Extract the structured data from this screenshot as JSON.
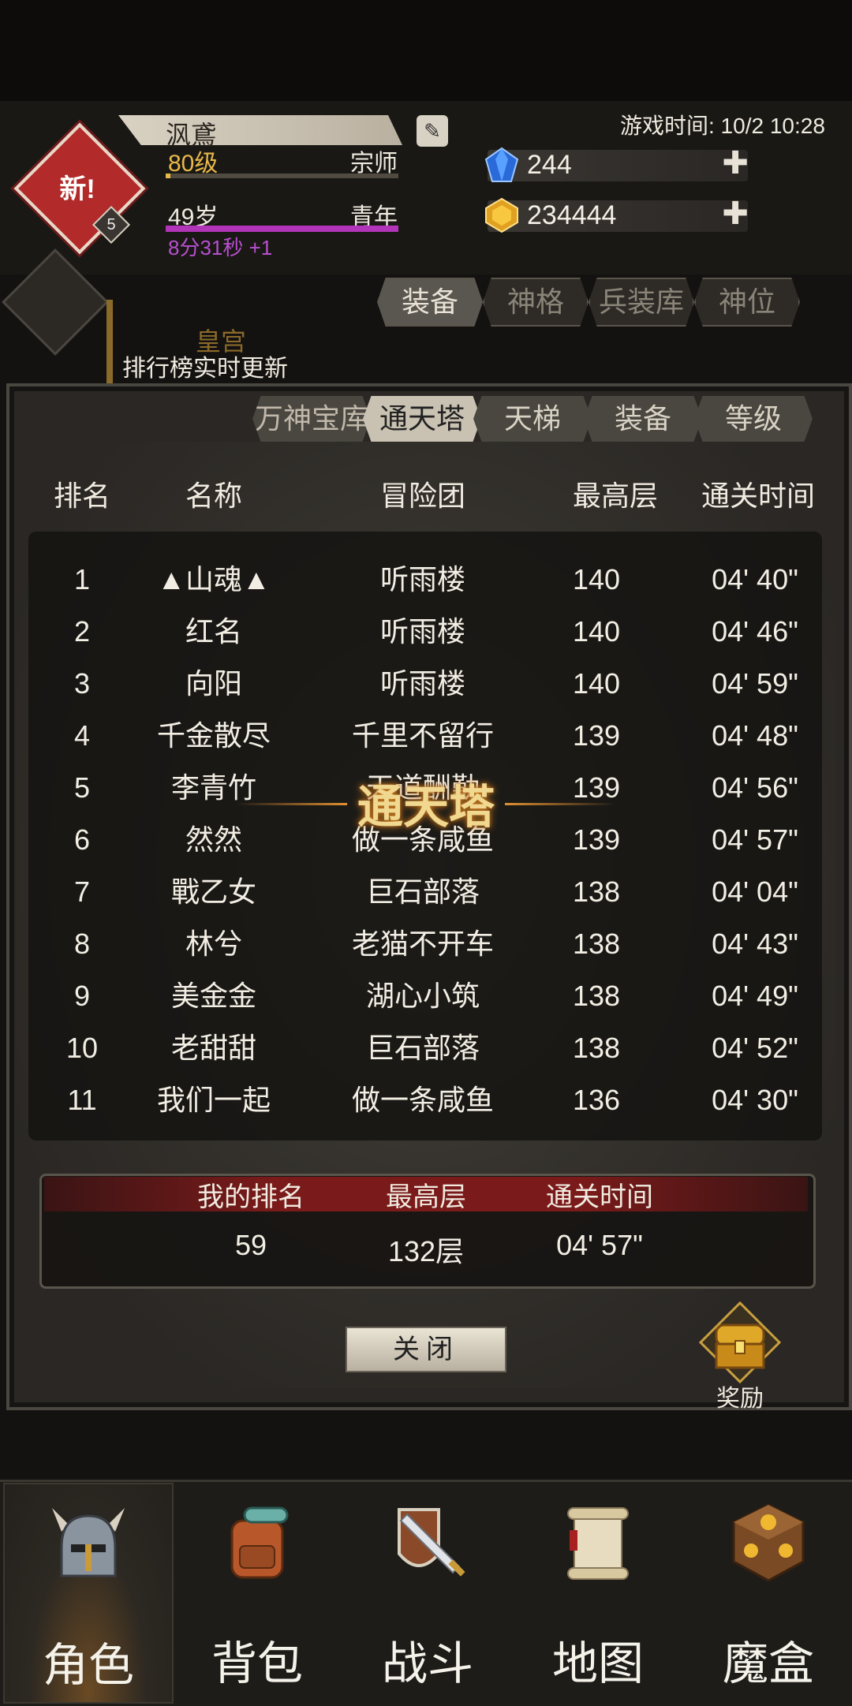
{
  "header": {
    "player_name": "沨鳶",
    "level": "80级",
    "rank_title": "宗师",
    "age": "49岁",
    "age_stage": "青年",
    "timer": "8分31秒 +1",
    "avatar_badge": "新!",
    "avatar_level": "5",
    "game_time": "游戏时间: 10/2 10:28",
    "currency": {
      "gems": "244",
      "gold": "234444"
    },
    "plus": "✚"
  },
  "top_tabs": [
    "装备",
    "神格",
    "兵装库",
    "神位"
  ],
  "background": {
    "palace": "皇宫",
    "realtime_notice": "排行榜实时更新"
  },
  "leaderboard": {
    "tabs": [
      "万神宝库",
      "通天塔",
      "天梯",
      "装备",
      "等级"
    ],
    "active_tab": "通天塔",
    "columns": [
      "排名",
      "名称",
      "冒险团",
      "最高层",
      "通关时间"
    ],
    "rows": [
      {
        "rank": "1",
        "name": "▲山魂▲",
        "guild": "听雨楼",
        "floor": "140",
        "time": "04' 40\""
      },
      {
        "rank": "2",
        "name": "红名",
        "guild": "听雨楼",
        "floor": "140",
        "time": "04' 46\""
      },
      {
        "rank": "3",
        "name": "向阳",
        "guild": "听雨楼",
        "floor": "140",
        "time": "04' 59\""
      },
      {
        "rank": "4",
        "name": "千金散尽",
        "guild": "千里不留行",
        "floor": "139",
        "time": "04' 48\""
      },
      {
        "rank": "5",
        "name": "李青竹",
        "guild": "天道酬勤",
        "floor": "139",
        "time": "04' 56\""
      },
      {
        "rank": "6",
        "name": "然然",
        "guild": "做一条咸鱼",
        "floor": "139",
        "time": "04' 57\""
      },
      {
        "rank": "7",
        "name": "戰乙女",
        "guild": "巨石部落",
        "floor": "138",
        "time": "04' 04\""
      },
      {
        "rank": "8",
        "name": "林兮",
        "guild": "老猫不开车",
        "floor": "138",
        "time": "04' 43\""
      },
      {
        "rank": "9",
        "name": "美金金",
        "guild": "湖心小筑",
        "floor": "138",
        "time": "04' 49\""
      },
      {
        "rank": "10",
        "name": "老甜甜",
        "guild": "巨石部落",
        "floor": "138",
        "time": "04' 52\""
      },
      {
        "rank": "11",
        "name": "我们一起",
        "guild": "做一条咸鱼",
        "floor": "136",
        "time": "04' 30\""
      }
    ],
    "watermark": "通天塔",
    "my_rank": {
      "headers": [
        "我的排名",
        "最高层",
        "通关时间"
      ],
      "rank": "59",
      "floor": "132层",
      "time": "04' 57\""
    },
    "close_label": "关闭",
    "reward_label": "奖励"
  },
  "bottom_nav": [
    {
      "label": "角色",
      "icon": "helmet-icon",
      "active": true
    },
    {
      "label": "背包",
      "icon": "backpack-icon",
      "active": false
    },
    {
      "label": "战斗",
      "icon": "sword-shield-icon",
      "active": false
    },
    {
      "label": "地图",
      "icon": "scroll-map-icon",
      "active": false
    },
    {
      "label": "魔盒",
      "icon": "magic-box-icon",
      "active": false
    }
  ],
  "colors": {
    "accent_gold": "#e8b84a",
    "age_bar": "#b234b8",
    "my_rank_header": "#7a1a1a"
  }
}
